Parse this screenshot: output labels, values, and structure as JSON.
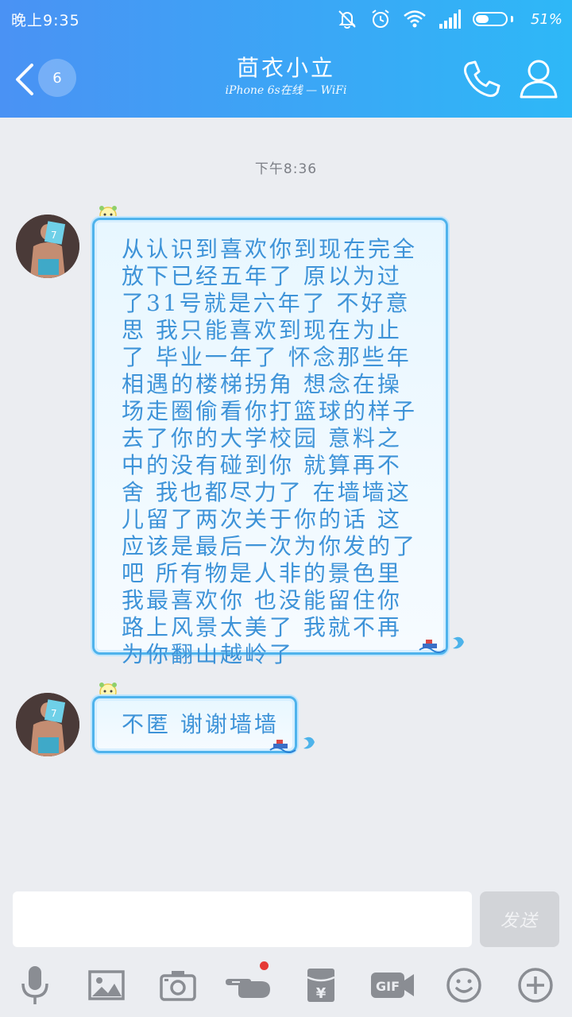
{
  "status_bar": {
    "time": "晚上9:35",
    "battery_percent": "51%",
    "battery_level": 0.51,
    "icons": [
      "alarm-off-icon",
      "alarm-clock-icon",
      "wifi-icon",
      "signal-icon",
      "battery-icon"
    ]
  },
  "header": {
    "unread_count": "6",
    "title": "茴衣小立",
    "subtitle": "iPhone 6s在线 — WiFi",
    "icons": [
      "back-arrow-icon",
      "phone-icon",
      "person-icon"
    ]
  },
  "chat": {
    "timestamp": "下午8:36",
    "messages": [
      {
        "sender": "other",
        "text": "从认识到喜欢你到现在完全\n放下已经五年了 原以为过\n了31号就是六年了 不好意\n思 我只能喜欢到现在为止\n了 毕业一年了 怀念那些年\n相遇的楼梯拐角 想念在操\n场走圈偷看你打篮球的样子\n去了你的大学校园 意料之\n中的没有碰到你 就算再不\n舍 我也都尽力了 在墙墙这\n儿留了两次关于你的话 这\n应该是最后一次为你发的了\n吧 所有物是人非的景色里\n我最喜欢你 也没能留住你\n路上风景太美了 我就不再\n为你翻山越岭了"
      },
      {
        "sender": "other",
        "text": "不匿 谢谢墙墙"
      }
    ]
  },
  "composer": {
    "input_value": "",
    "send_label": "发送"
  },
  "toolbar": {
    "items": [
      "microphone-icon",
      "image-icon",
      "camera-icon",
      "poke-hand-icon",
      "red-packet-icon",
      "gif-icon",
      "emoji-icon",
      "plus-icon"
    ],
    "gif_label": "GIF",
    "yen_symbol": "¥"
  },
  "colors": {
    "header_gradient_start": "#4a92f4",
    "header_gradient_end": "#2eb8f7",
    "bubble_border": "#4fb3ec",
    "bubble_text": "#3e93d8",
    "chat_background": "#ebedf1",
    "badge_red": "#e53935"
  }
}
